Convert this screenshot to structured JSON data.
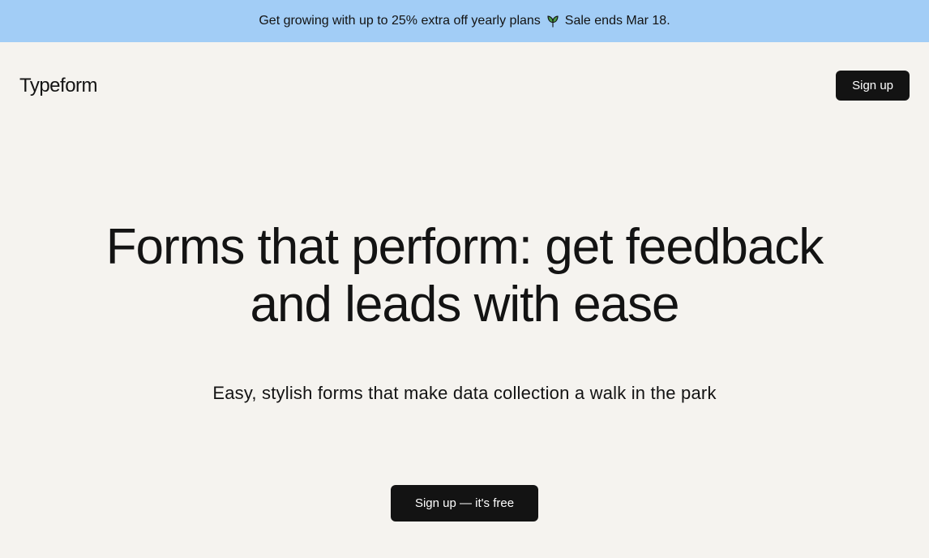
{
  "banner": {
    "text_before": "Get growing with up to 25% extra off yearly plans",
    "text_after": "Sale ends Mar 18.",
    "icon": "seedling-icon"
  },
  "header": {
    "logo": "Typeform",
    "signup_label": "Sign up"
  },
  "hero": {
    "title": "Forms that perform: get feedback and leads with ease",
    "subtitle": "Easy, stylish forms that make data collection a walk in the park",
    "cta_label": "Sign up — it's free"
  }
}
